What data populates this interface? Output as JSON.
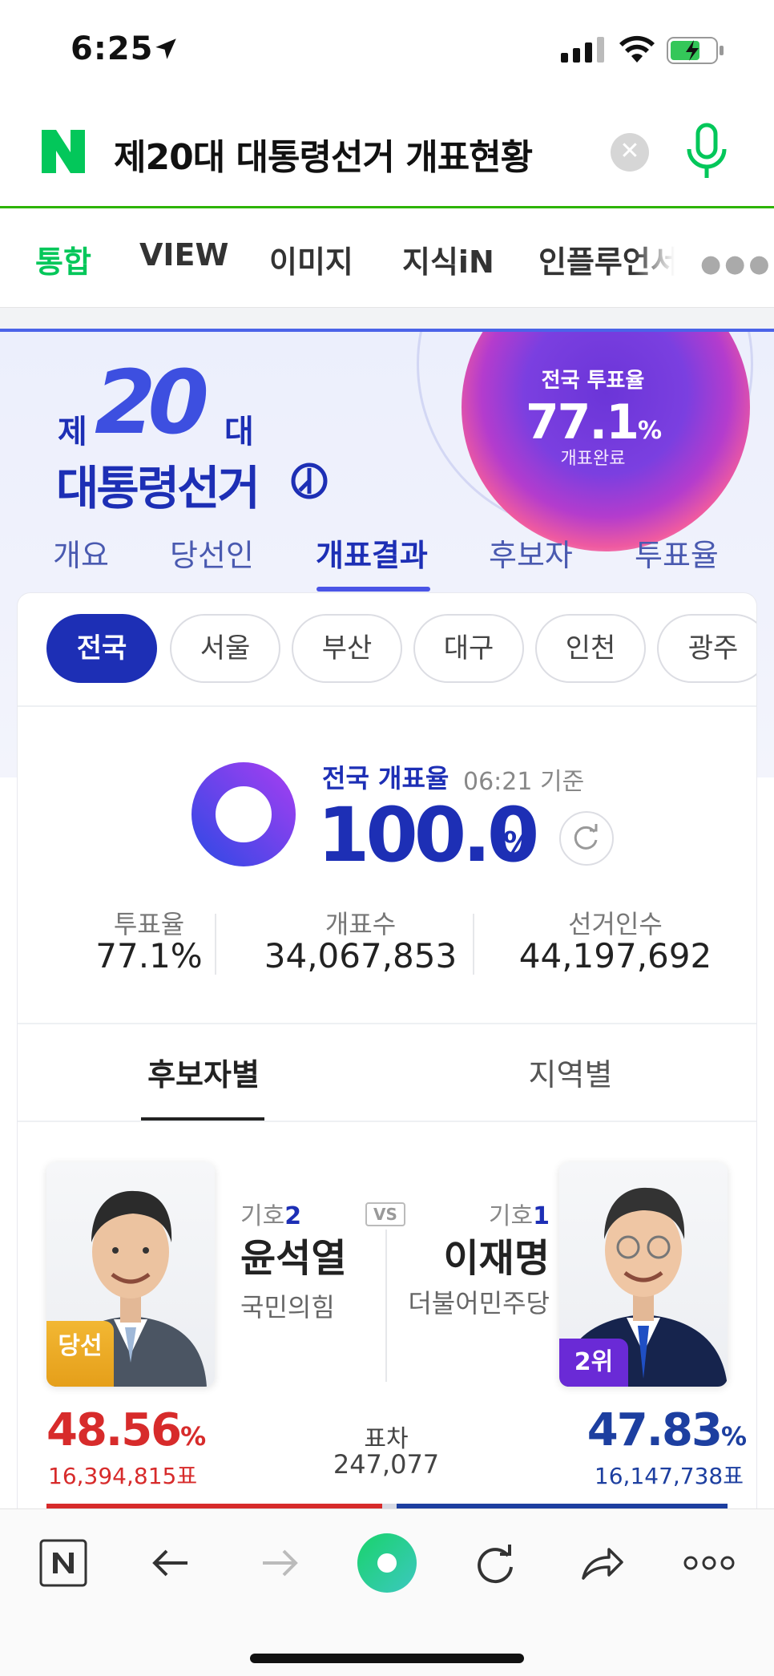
{
  "status_bar": {
    "time": "6:25",
    "icons": [
      "location-arrow-icon",
      "signal-icon",
      "wifi-icon",
      "battery-charging-icon"
    ],
    "battery_color": "#34c759"
  },
  "search": {
    "logo": "N",
    "query": "제20대 대통령선거 개표현황",
    "clear_icon": "close-icon",
    "mic_icon": "mic-icon",
    "brand_color": "#03c75a"
  },
  "tabs": [
    "통합",
    "VIEW",
    "이미지",
    "지식iN",
    "인플루언서"
  ],
  "tabs_active": 0,
  "hero": {
    "logo_je": "제",
    "logo_num": "20",
    "logo_dae": "대",
    "logo_title": "대통령선거",
    "turnout_label": "전국 투표율",
    "turnout_value": "77.1",
    "turnout_unit": "%",
    "turnout_sub": "개표완료",
    "subtabs": [
      "개요",
      "당선인",
      "개표결과",
      "후보자",
      "투표율"
    ],
    "subtabs_active": 2
  },
  "regions": [
    "전국",
    "서울",
    "부산",
    "대구",
    "인천",
    "광주"
  ],
  "regions_active": 0,
  "progress": {
    "label": "전국 개표율",
    "time": "06:21 기준",
    "value": "100.0",
    "unit": "%",
    "fraction": 1.0
  },
  "stats": [
    {
      "label": "투표율",
      "value": "77.1%"
    },
    {
      "label": "개표수",
      "value": "34,067,853"
    },
    {
      "label": "선거인수",
      "value": "44,197,692"
    }
  ],
  "section_tabs": [
    "후보자별",
    "지역별"
  ],
  "section_active": 0,
  "candidates": {
    "left": {
      "num_prefix": "기호",
      "num": "2",
      "name": "윤석열",
      "party": "국민의힘",
      "badge": "당선",
      "pct": "48.56",
      "pct_unit": "%",
      "votes": "16,394,815표",
      "color": "#d72b2b",
      "share": 48.56
    },
    "vs": "VS",
    "right": {
      "num_prefix": "기호",
      "num": "1",
      "name": "이재명",
      "party": "더불어민주당",
      "badge": "2위",
      "pct": "47.83",
      "pct_unit": "%",
      "votes": "16,147,738표",
      "color": "#1d3fa0",
      "share": 47.83
    }
  },
  "gap": {
    "label": "표차",
    "value": "247,077"
  },
  "toolbar": [
    "naver-home-icon",
    "back-icon",
    "forward-icon",
    "green-dot-icon",
    "reload-icon",
    "share-icon",
    "more-icon"
  ]
}
